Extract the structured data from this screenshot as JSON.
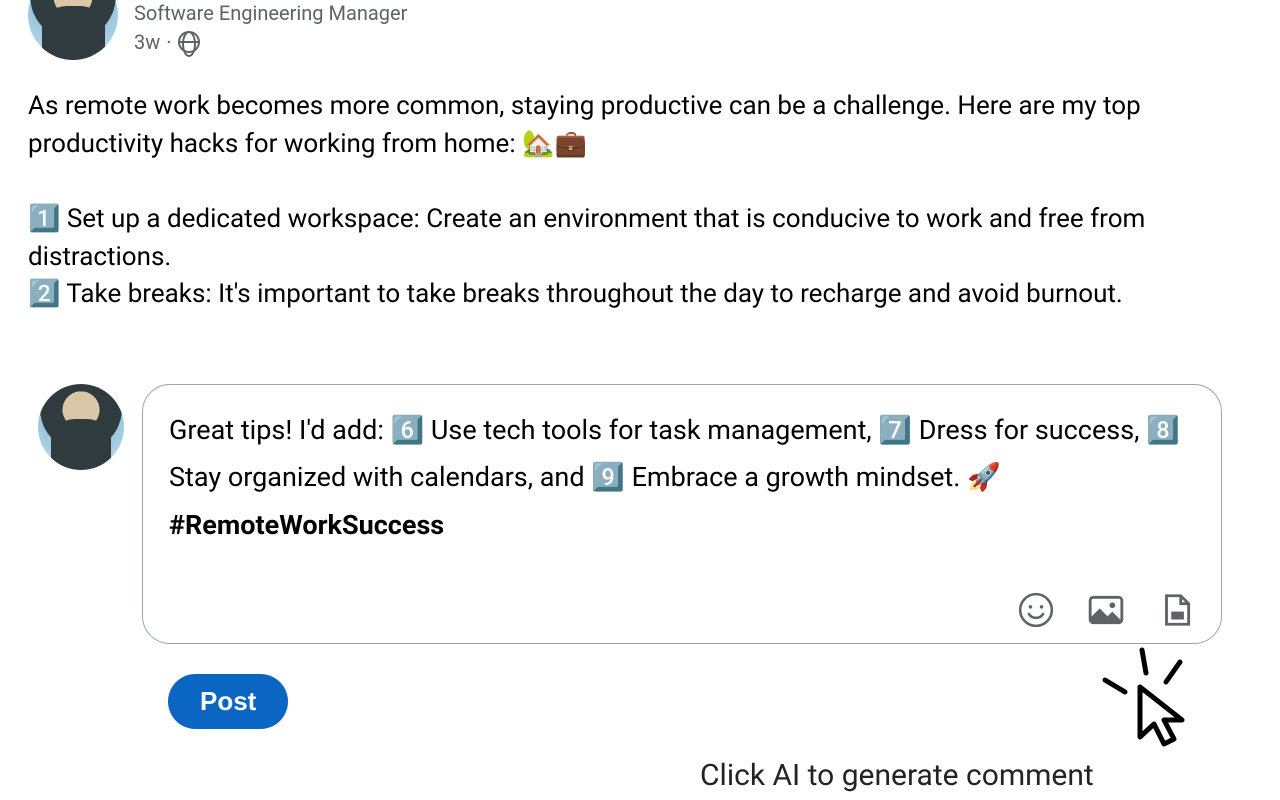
{
  "post": {
    "headline": "Software Engineering Manager",
    "time": "3w",
    "separator": "·",
    "body": "As remote work becomes more common, staying productive can be a challenge. Here are my top productivity hacks for working from home: 🏡💼\n\n1️⃣ Set up a dedicated workspace: Create an environment that is conducive to work and free from distractions.\n2️⃣ Take breaks: It's important to take breaks throughout the day to recharge and avoid burnout."
  },
  "comment": {
    "text_prefix": "Great tips! I'd add: 6️⃣ Use tech tools for task management, 7️⃣ Dress for success, 8️⃣ Stay organized with calendars, and 9️⃣ Embrace a growth mindset. 🚀 ",
    "hashtag": "#RemoteWorkSuccess"
  },
  "buttons": {
    "post": "Post"
  },
  "callout": "Click AI to generate comment"
}
